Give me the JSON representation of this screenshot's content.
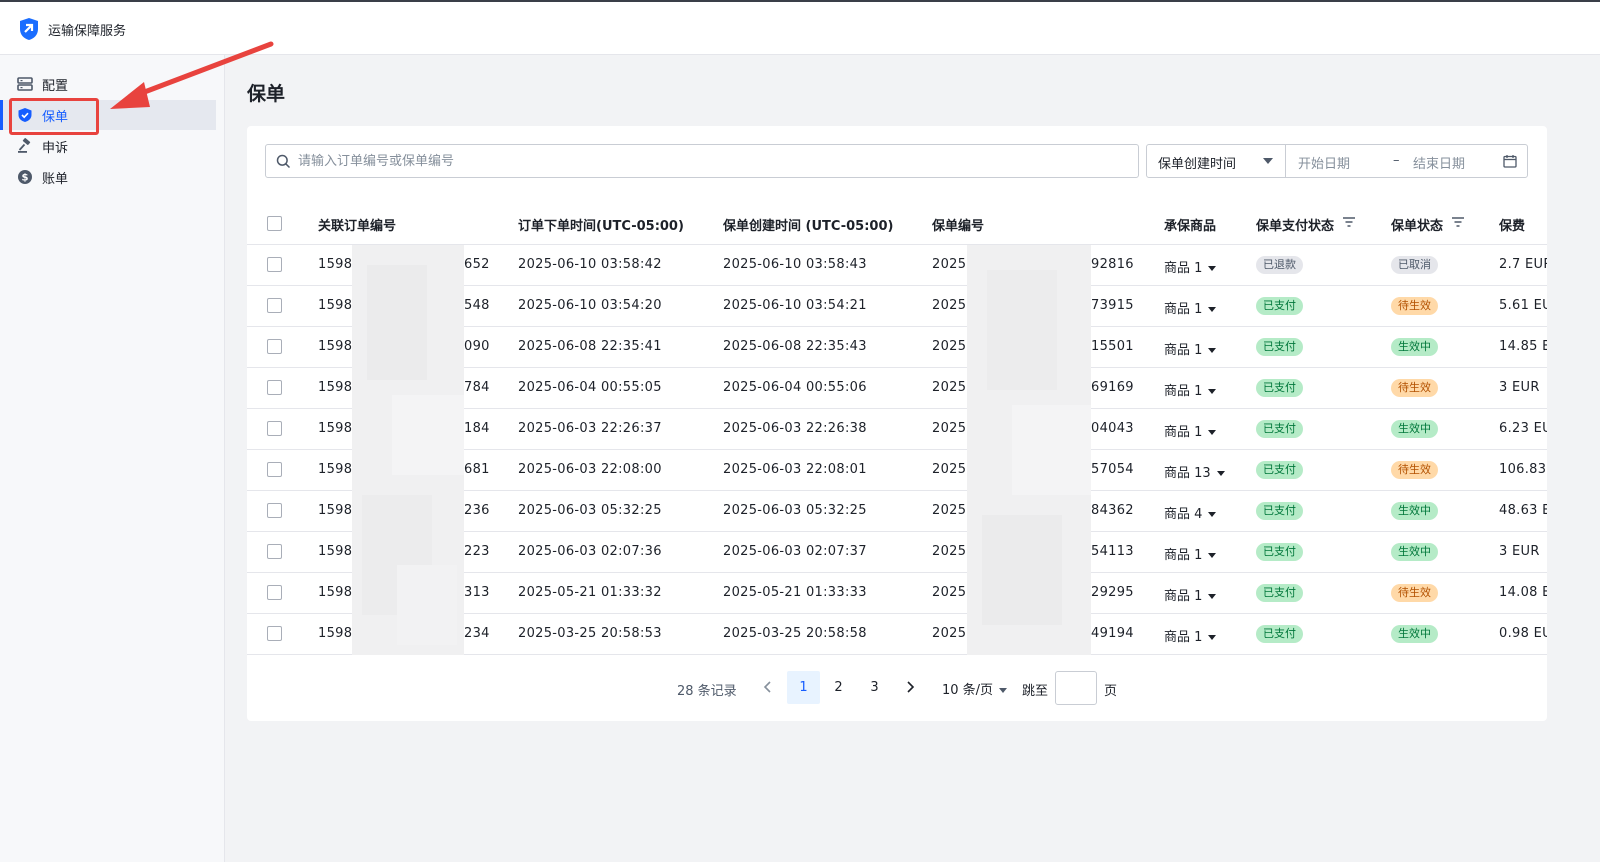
{
  "app": {
    "title": "运输保障服务"
  },
  "sidebar": {
    "items": [
      {
        "label": "配置",
        "icon": "server-icon",
        "active": false
      },
      {
        "label": "保单",
        "icon": "shield-check-icon",
        "active": true
      },
      {
        "label": "申诉",
        "icon": "gavel-icon",
        "active": false
      },
      {
        "label": "账单",
        "icon": "dollar-circle-icon",
        "active": false
      }
    ]
  },
  "page": {
    "title": "保单"
  },
  "search": {
    "placeholder": "请输入订单编号或保单编号",
    "value": ""
  },
  "date_filter": {
    "field": "保单创建时间",
    "start_placeholder": "开始日期",
    "separator": "–",
    "end_placeholder": "结束日期"
  },
  "table": {
    "columns": {
      "order_no": "关联订单编号",
      "order_time": "订单下单时间(UTC-05:00)",
      "policy_time": "保单创建时间 (UTC-05:00)",
      "policy_no": "保单编号",
      "product": "承保商品",
      "pay_status": "保单支付状态",
      "policy_status": "保单状态",
      "fee": "保费"
    },
    "rows": [
      {
        "order_prefix": "1598",
        "order_suffix": "652",
        "order_time": "2025-06-10 03:58:42",
        "policy_time": "2025-06-10 03:58:43",
        "policy_prefix": "2025",
        "policy_suffix": "92816",
        "product": "商品 1",
        "pay_status": "已退款",
        "pay_color": "gray",
        "policy_status": "已取消",
        "policy_color": "gray",
        "fee": "2.7 EUR"
      },
      {
        "order_prefix": "1598",
        "order_suffix": "548",
        "order_time": "2025-06-10 03:54:20",
        "policy_time": "2025-06-10 03:54:21",
        "policy_prefix": "2025",
        "policy_suffix": "73915",
        "product": "商品 1",
        "pay_status": "已支付",
        "pay_color": "green",
        "policy_status": "待生效",
        "policy_color": "orange",
        "fee": "5.61 EU"
      },
      {
        "order_prefix": "1598",
        "order_suffix": "090",
        "order_time": "2025-06-08 22:35:41",
        "policy_time": "2025-06-08 22:35:43",
        "policy_prefix": "2025",
        "policy_suffix": "15501",
        "product": "商品 1",
        "pay_status": "已支付",
        "pay_color": "green",
        "policy_status": "生效中",
        "policy_color": "green",
        "fee": "14.85 E"
      },
      {
        "order_prefix": "1598",
        "order_suffix": "784",
        "order_time": "2025-06-04 00:55:05",
        "policy_time": "2025-06-04 00:55:06",
        "policy_prefix": "2025",
        "policy_suffix": "69169",
        "product": "商品 1",
        "pay_status": "已支付",
        "pay_color": "green",
        "policy_status": "待生效",
        "policy_color": "orange",
        "fee": "3 EUR"
      },
      {
        "order_prefix": "1598",
        "order_suffix": "184",
        "order_time": "2025-06-03 22:26:37",
        "policy_time": "2025-06-03 22:26:38",
        "policy_prefix": "2025",
        "policy_suffix": "04043",
        "product": "商品 1",
        "pay_status": "已支付",
        "pay_color": "green",
        "policy_status": "生效中",
        "policy_color": "green",
        "fee": "6.23 EU"
      },
      {
        "order_prefix": "1598",
        "order_suffix": "681",
        "order_time": "2025-06-03 22:08:00",
        "policy_time": "2025-06-03 22:08:01",
        "policy_prefix": "2025",
        "policy_suffix": "57054",
        "product": "商品 13",
        "pay_status": "已支付",
        "pay_color": "green",
        "policy_status": "待生效",
        "policy_color": "orange",
        "fee": "106.83"
      },
      {
        "order_prefix": "1598",
        "order_suffix": "236",
        "order_time": "2025-06-03 05:32:25",
        "policy_time": "2025-06-03 05:32:25",
        "policy_prefix": "2025",
        "policy_suffix": "84362",
        "product": "商品 4",
        "pay_status": "已支付",
        "pay_color": "green",
        "policy_status": "生效中",
        "policy_color": "green",
        "fee": "48.63 E"
      },
      {
        "order_prefix": "1598",
        "order_suffix": "223",
        "order_time": "2025-06-03 02:07:36",
        "policy_time": "2025-06-03 02:07:37",
        "policy_prefix": "2025",
        "policy_suffix": "54113",
        "product": "商品 1",
        "pay_status": "已支付",
        "pay_color": "green",
        "policy_status": "生效中",
        "policy_color": "green",
        "fee": "3 EUR"
      },
      {
        "order_prefix": "1598",
        "order_suffix": "313",
        "order_time": "2025-05-21 01:33:32",
        "policy_time": "2025-05-21 01:33:33",
        "policy_prefix": "2025",
        "policy_suffix": "29295",
        "product": "商品 1",
        "pay_status": "已支付",
        "pay_color": "green",
        "policy_status": "待生效",
        "policy_color": "orange",
        "fee": "14.08 E"
      },
      {
        "order_prefix": "1598",
        "order_suffix": "234",
        "order_time": "2025-03-25 20:58:53",
        "policy_time": "2025-03-25 20:58:58",
        "policy_prefix": "2025",
        "policy_suffix": "49194",
        "product": "商品 1",
        "pay_status": "已支付",
        "pay_color": "green",
        "policy_status": "生效中",
        "policy_color": "green",
        "fee": "0.98 EU"
      }
    ]
  },
  "pagination": {
    "total_label": "28 条记录",
    "pages": [
      "1",
      "2",
      "3"
    ],
    "current": "1",
    "page_size": "10 条/页",
    "jump_label": "跳至",
    "page_unit": "页",
    "jump_value": ""
  },
  "colors": {
    "accent": "#165dff",
    "annotation_red": "#e8433e",
    "tag_green_bg": "#b5ebc7",
    "tag_orange_bg": "#ffd9a8",
    "tag_gray_bg": "#e5e6eb"
  }
}
